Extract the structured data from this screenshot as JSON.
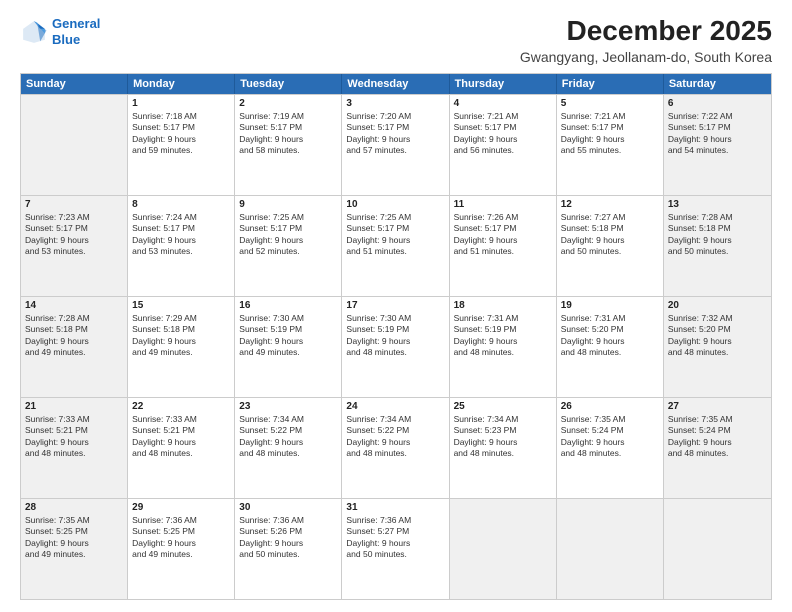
{
  "logo": {
    "line1": "General",
    "line2": "Blue"
  },
  "title": "December 2025",
  "subtitle": "Gwangyang, Jeollanam-do, South Korea",
  "headers": [
    "Sunday",
    "Monday",
    "Tuesday",
    "Wednesday",
    "Thursday",
    "Friday",
    "Saturday"
  ],
  "weeks": [
    [
      {
        "day": "",
        "lines": []
      },
      {
        "day": "1",
        "lines": [
          "Sunrise: 7:18 AM",
          "Sunset: 5:17 PM",
          "Daylight: 9 hours",
          "and 59 minutes."
        ]
      },
      {
        "day": "2",
        "lines": [
          "Sunrise: 7:19 AM",
          "Sunset: 5:17 PM",
          "Daylight: 9 hours",
          "and 58 minutes."
        ]
      },
      {
        "day": "3",
        "lines": [
          "Sunrise: 7:20 AM",
          "Sunset: 5:17 PM",
          "Daylight: 9 hours",
          "and 57 minutes."
        ]
      },
      {
        "day": "4",
        "lines": [
          "Sunrise: 7:21 AM",
          "Sunset: 5:17 PM",
          "Daylight: 9 hours",
          "and 56 minutes."
        ]
      },
      {
        "day": "5",
        "lines": [
          "Sunrise: 7:21 AM",
          "Sunset: 5:17 PM",
          "Daylight: 9 hours",
          "and 55 minutes."
        ]
      },
      {
        "day": "6",
        "lines": [
          "Sunrise: 7:22 AM",
          "Sunset: 5:17 PM",
          "Daylight: 9 hours",
          "and 54 minutes."
        ]
      }
    ],
    [
      {
        "day": "7",
        "lines": [
          "Sunrise: 7:23 AM",
          "Sunset: 5:17 PM",
          "Daylight: 9 hours",
          "and 53 minutes."
        ]
      },
      {
        "day": "8",
        "lines": [
          "Sunrise: 7:24 AM",
          "Sunset: 5:17 PM",
          "Daylight: 9 hours",
          "and 53 minutes."
        ]
      },
      {
        "day": "9",
        "lines": [
          "Sunrise: 7:25 AM",
          "Sunset: 5:17 PM",
          "Daylight: 9 hours",
          "and 52 minutes."
        ]
      },
      {
        "day": "10",
        "lines": [
          "Sunrise: 7:25 AM",
          "Sunset: 5:17 PM",
          "Daylight: 9 hours",
          "and 51 minutes."
        ]
      },
      {
        "day": "11",
        "lines": [
          "Sunrise: 7:26 AM",
          "Sunset: 5:17 PM",
          "Daylight: 9 hours",
          "and 51 minutes."
        ]
      },
      {
        "day": "12",
        "lines": [
          "Sunrise: 7:27 AM",
          "Sunset: 5:18 PM",
          "Daylight: 9 hours",
          "and 50 minutes."
        ]
      },
      {
        "day": "13",
        "lines": [
          "Sunrise: 7:28 AM",
          "Sunset: 5:18 PM",
          "Daylight: 9 hours",
          "and 50 minutes."
        ]
      }
    ],
    [
      {
        "day": "14",
        "lines": [
          "Sunrise: 7:28 AM",
          "Sunset: 5:18 PM",
          "Daylight: 9 hours",
          "and 49 minutes."
        ]
      },
      {
        "day": "15",
        "lines": [
          "Sunrise: 7:29 AM",
          "Sunset: 5:18 PM",
          "Daylight: 9 hours",
          "and 49 minutes."
        ]
      },
      {
        "day": "16",
        "lines": [
          "Sunrise: 7:30 AM",
          "Sunset: 5:19 PM",
          "Daylight: 9 hours",
          "and 49 minutes."
        ]
      },
      {
        "day": "17",
        "lines": [
          "Sunrise: 7:30 AM",
          "Sunset: 5:19 PM",
          "Daylight: 9 hours",
          "and 48 minutes."
        ]
      },
      {
        "day": "18",
        "lines": [
          "Sunrise: 7:31 AM",
          "Sunset: 5:19 PM",
          "Daylight: 9 hours",
          "and 48 minutes."
        ]
      },
      {
        "day": "19",
        "lines": [
          "Sunrise: 7:31 AM",
          "Sunset: 5:20 PM",
          "Daylight: 9 hours",
          "and 48 minutes."
        ]
      },
      {
        "day": "20",
        "lines": [
          "Sunrise: 7:32 AM",
          "Sunset: 5:20 PM",
          "Daylight: 9 hours",
          "and 48 minutes."
        ]
      }
    ],
    [
      {
        "day": "21",
        "lines": [
          "Sunrise: 7:33 AM",
          "Sunset: 5:21 PM",
          "Daylight: 9 hours",
          "and 48 minutes."
        ]
      },
      {
        "day": "22",
        "lines": [
          "Sunrise: 7:33 AM",
          "Sunset: 5:21 PM",
          "Daylight: 9 hours",
          "and 48 minutes."
        ]
      },
      {
        "day": "23",
        "lines": [
          "Sunrise: 7:34 AM",
          "Sunset: 5:22 PM",
          "Daylight: 9 hours",
          "and 48 minutes."
        ]
      },
      {
        "day": "24",
        "lines": [
          "Sunrise: 7:34 AM",
          "Sunset: 5:22 PM",
          "Daylight: 9 hours",
          "and 48 minutes."
        ]
      },
      {
        "day": "25",
        "lines": [
          "Sunrise: 7:34 AM",
          "Sunset: 5:23 PM",
          "Daylight: 9 hours",
          "and 48 minutes."
        ]
      },
      {
        "day": "26",
        "lines": [
          "Sunrise: 7:35 AM",
          "Sunset: 5:24 PM",
          "Daylight: 9 hours",
          "and 48 minutes."
        ]
      },
      {
        "day": "27",
        "lines": [
          "Sunrise: 7:35 AM",
          "Sunset: 5:24 PM",
          "Daylight: 9 hours",
          "and 48 minutes."
        ]
      }
    ],
    [
      {
        "day": "28",
        "lines": [
          "Sunrise: 7:35 AM",
          "Sunset: 5:25 PM",
          "Daylight: 9 hours",
          "and 49 minutes."
        ]
      },
      {
        "day": "29",
        "lines": [
          "Sunrise: 7:36 AM",
          "Sunset: 5:25 PM",
          "Daylight: 9 hours",
          "and 49 minutes."
        ]
      },
      {
        "day": "30",
        "lines": [
          "Sunrise: 7:36 AM",
          "Sunset: 5:26 PM",
          "Daylight: 9 hours",
          "and 50 minutes."
        ]
      },
      {
        "day": "31",
        "lines": [
          "Sunrise: 7:36 AM",
          "Sunset: 5:27 PM",
          "Daylight: 9 hours",
          "and 50 minutes."
        ]
      },
      {
        "day": "",
        "lines": []
      },
      {
        "day": "",
        "lines": []
      },
      {
        "day": "",
        "lines": []
      }
    ]
  ]
}
